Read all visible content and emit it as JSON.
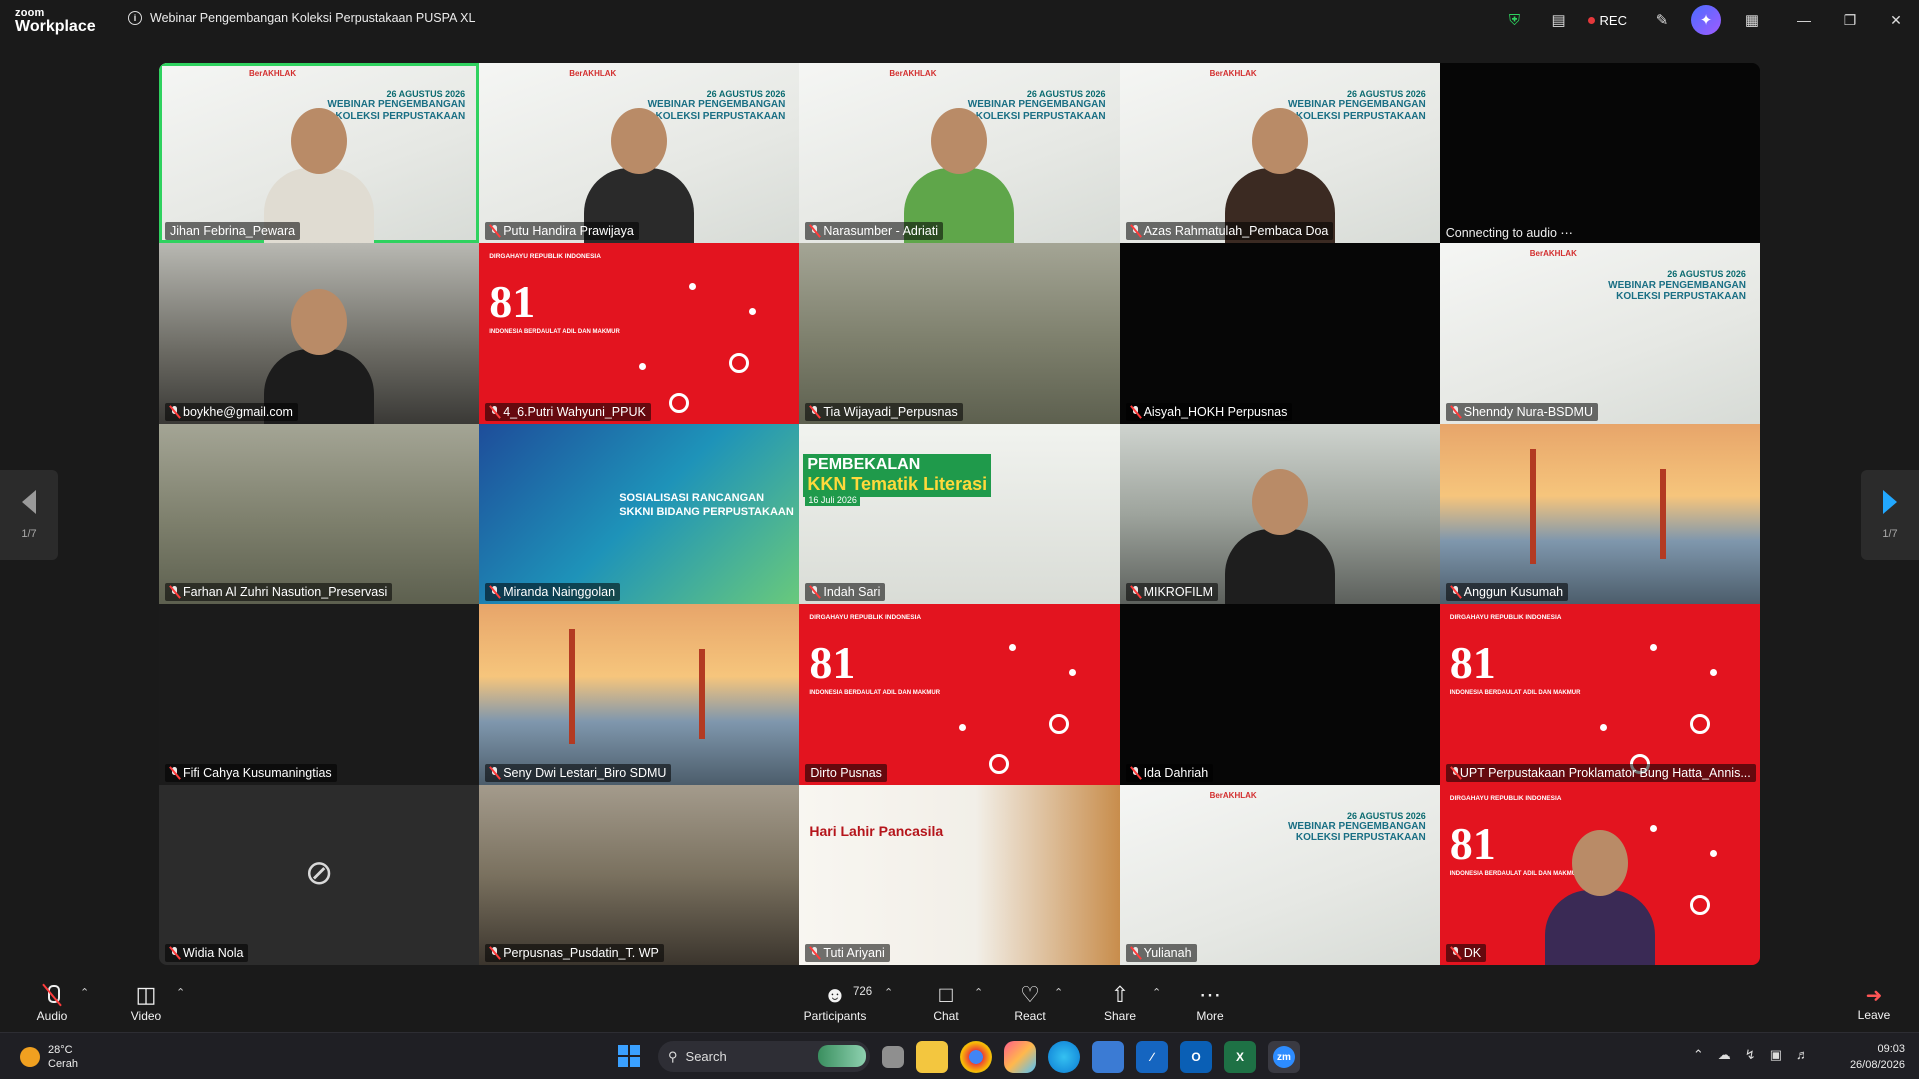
{
  "titlebar": {
    "brand_small": "zoom",
    "brand_large": "Workplace",
    "meeting_title": "Webinar Pengembangan Koleksi Perpustakaan PUSPA XL",
    "rec_label": "REC"
  },
  "banner": {
    "line1": "26 AGUSTUS 2026",
    "line2": "WEBINAR PENGEMBANGAN",
    "line3": "KOLEKSI PERPUSTAKAAN",
    "tag": "BerAKHLAK"
  },
  "red_slide": {
    "top": "DIRGAHAYU REPUBLIK INDONESIA",
    "number": "81",
    "tagline": "INDONESIA BERDAULAT ADIL DAN MAKMUR"
  },
  "sosialisasi": {
    "line1": "SOSIALISASI RANCANGAN",
    "line2": "SKKNI BIDANG PERPUSTAKAAN"
  },
  "kkn": {
    "line1": "PEMBEKALAN",
    "line2": "KKN Tematik Literasi",
    "date": "16 Juli 2026"
  },
  "pancasila": {
    "title": "Hari Lahir Pancasila"
  },
  "participants": [
    {
      "name": "Jihan Febrina_Pewara",
      "muted": false,
      "bg": "white",
      "active": true
    },
    {
      "name": "Putu Handira Prawijaya",
      "muted": true,
      "bg": "white"
    },
    {
      "name": "Narasumber - Adriati",
      "muted": true,
      "bg": "white"
    },
    {
      "name": "Azas Rahmatulah_Pembaca Doa",
      "muted": true,
      "bg": "white"
    },
    {
      "name": "Connecting to audio",
      "muted": false,
      "bg": "black"
    },
    {
      "name": "boykhe@gmail.com",
      "muted": true,
      "bg": "station"
    },
    {
      "name": "4_6.Putri Wahyuni_PPUK",
      "muted": true,
      "bg": "red"
    },
    {
      "name": "Tia Wijayadi_Perpusnas",
      "muted": true,
      "bg": "hall"
    },
    {
      "name": "Aisyah_HOKH Perpusnas",
      "muted": true,
      "bg": "black"
    },
    {
      "name": "Shenndy Nura-BSDMU",
      "muted": true,
      "bg": "white"
    },
    {
      "name": "Farhan Al Zuhri Nasution_Preservasi",
      "muted": true,
      "bg": "hall"
    },
    {
      "name": "Miranda Nainggolan",
      "muted": true,
      "bg": "blue"
    },
    {
      "name": "Indah Sari",
      "muted": true,
      "bg": "kkn"
    },
    {
      "name": "MIKROFILM",
      "muted": true,
      "bg": "office"
    },
    {
      "name": "Anggun Kusumah",
      "muted": true,
      "bg": "bridge"
    },
    {
      "name": "Fifi Cahya Kusumaningtias",
      "muted": true,
      "bg": "dark"
    },
    {
      "name": "Seny Dwi Lestari_Biro SDMU",
      "muted": true,
      "bg": "bridge"
    },
    {
      "name": "Dirto Pusnas",
      "muted": false,
      "bg": "red"
    },
    {
      "name": "Ida Dahriah",
      "muted": true,
      "bg": "black"
    },
    {
      "name": "UPT Perpustakaan Proklamator Bung Hatta_Annis...",
      "muted": true,
      "bg": "red"
    },
    {
      "name": "Widia Nola",
      "muted": true,
      "bg": "grey"
    },
    {
      "name": "Perpusnas_Pusdatin_T. WP",
      "muted": true,
      "bg": "room"
    },
    {
      "name": "Tuti Ariyani",
      "muted": true,
      "bg": "pancasila"
    },
    {
      "name": "Yulianah",
      "muted": true,
      "bg": "white"
    },
    {
      "name": "DK",
      "muted": true,
      "bg": "red"
    }
  ],
  "pagination": {
    "left": "1/7",
    "right": "1/7"
  },
  "toolbar": {
    "audio": "Audio",
    "video": "Video",
    "participants": "Participants",
    "participant_count": "726",
    "chat": "Chat",
    "react": "React",
    "share": "Share",
    "more": "More",
    "leave": "Leave"
  },
  "taskbar": {
    "temp": "28°C",
    "weather": "Cerah",
    "search_placeholder": "Search",
    "time": "09:03",
    "date": "26/08/2026"
  },
  "colors": {
    "active_border": "#2fd25f",
    "rec_dot": "#e5383b",
    "red_slide": "#e3141f",
    "muted_mic": "#ff3b3b"
  }
}
